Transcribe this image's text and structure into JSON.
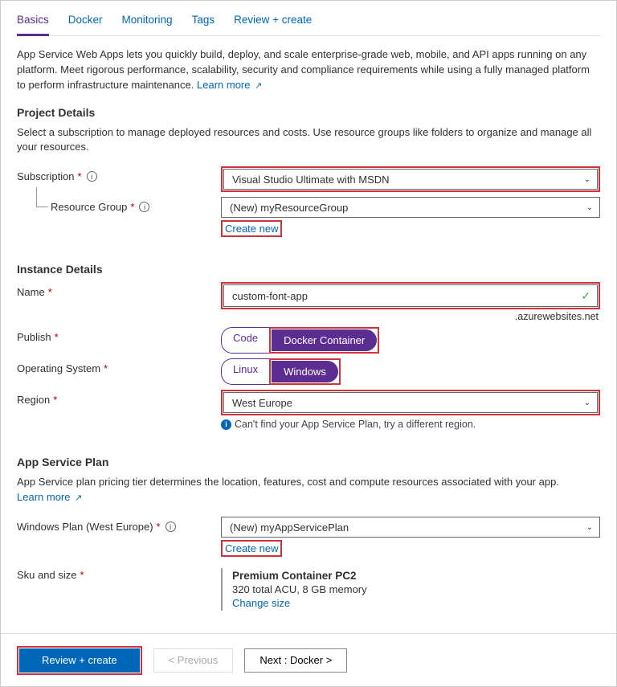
{
  "tabs": {
    "basics": "Basics",
    "docker": "Docker",
    "monitoring": "Monitoring",
    "tags": "Tags",
    "review": "Review + create"
  },
  "intro": {
    "text": "App Service Web Apps lets you quickly build, deploy, and scale enterprise-grade web, mobile, and API apps running on any platform. Meet rigorous performance, scalability, security and compliance requirements while using a fully managed platform to perform infrastructure maintenance.  ",
    "learn_more": "Learn more"
  },
  "project": {
    "heading": "Project Details",
    "desc": "Select a subscription to manage deployed resources and costs. Use resource groups like folders to organize and manage all your resources.",
    "subscription_label": "Subscription",
    "subscription_value": "Visual Studio Ultimate with MSDN",
    "rg_label": "Resource Group",
    "rg_value": "(New) myResourceGroup",
    "create_new": "Create new"
  },
  "instance": {
    "heading": "Instance Details",
    "name_label": "Name",
    "name_value": "custom-font-app",
    "name_suffix": ".azurewebsites.net",
    "publish_label": "Publish",
    "publish_code": "Code",
    "publish_docker": "Docker Container",
    "os_label": "Operating System",
    "os_linux": "Linux",
    "os_windows": "Windows",
    "region_label": "Region",
    "region_value": "West Europe",
    "region_hint": "Can't find your App Service Plan, try a different region."
  },
  "plan": {
    "heading": "App Service Plan",
    "desc": "App Service plan pricing tier determines the location, features, cost and compute resources associated with your app.",
    "learn_more": "Learn more",
    "plan_label": "Windows Plan (West Europe)",
    "plan_value": "(New) myAppServicePlan",
    "create_new": "Create new",
    "sku_label": "Sku and size",
    "sku_title": "Premium Container PC2",
    "sku_desc": "320 total ACU, 8 GB memory",
    "change_size": "Change size"
  },
  "footer": {
    "review": "Review + create",
    "previous": "< Previous",
    "next": "Next : Docker >"
  }
}
